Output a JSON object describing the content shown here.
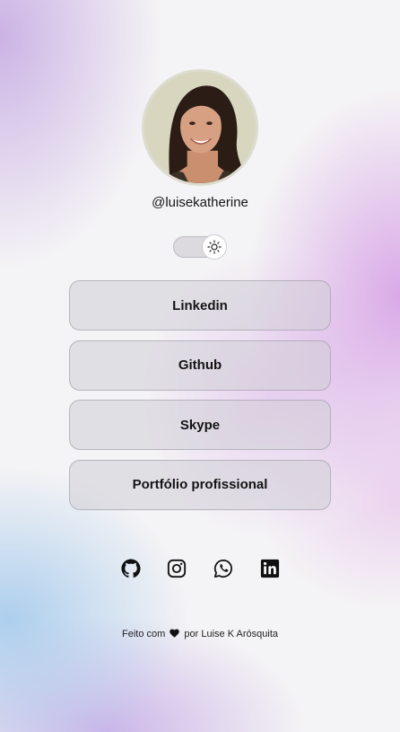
{
  "profile": {
    "avatar_alt": "profile photo",
    "username": "@luisekatherine"
  },
  "theme_toggle": {
    "state": "light",
    "icon": "sun-icon"
  },
  "links": [
    {
      "label": "Linkedin"
    },
    {
      "label": "Github"
    },
    {
      "label": "Skype"
    },
    {
      "label": "Portfólio profissional"
    }
  ],
  "socials": [
    {
      "icon": "github-icon"
    },
    {
      "icon": "instagram-icon"
    },
    {
      "icon": "whatsapp-icon"
    },
    {
      "icon": "linkedin-icon"
    }
  ],
  "footer": {
    "prefix": "Feito com",
    "icon": "heart-icon",
    "suffix": "por Luise K Arósquita"
  }
}
